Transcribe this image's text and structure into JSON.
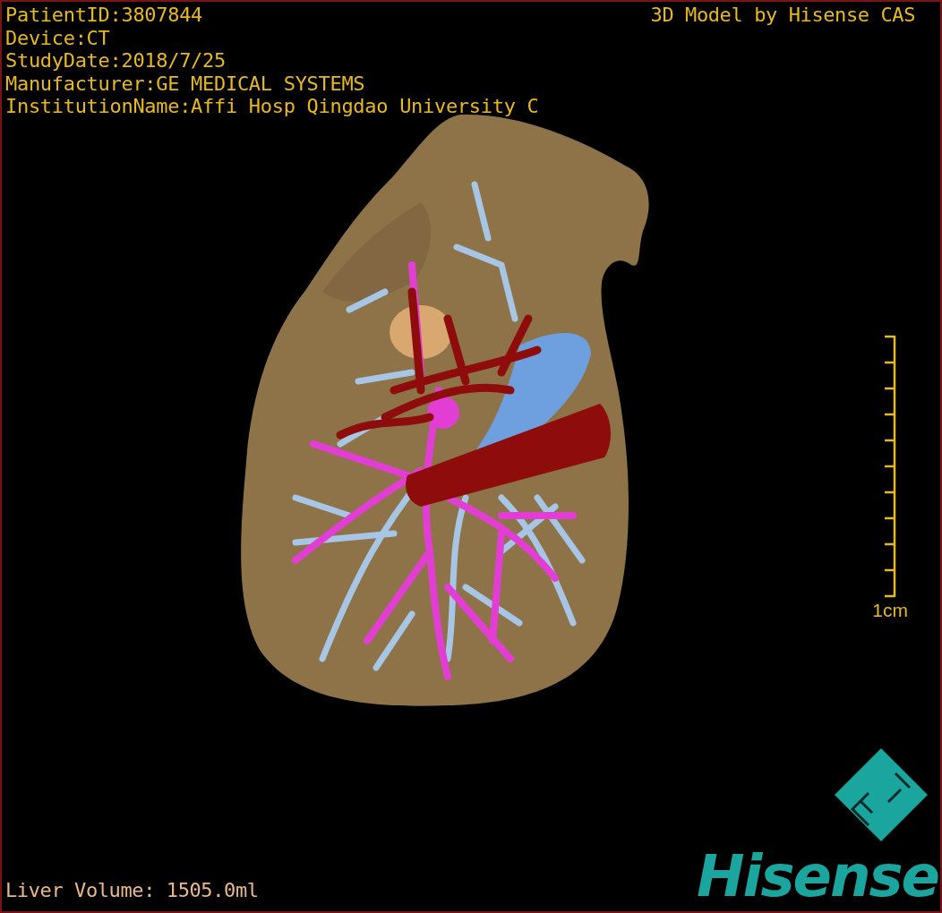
{
  "patient_info": [
    "PatientID:3807844",
    "Device:CT",
    "StudyDate:2018/7/25",
    "Manufacturer:GE MEDICAL SYSTEMS",
    "InstitutionName:Affi Hosp Qingdao University C"
  ],
  "credit": "3D Model by Hisense CAS",
  "scale_bar": {
    "label": "1cm"
  },
  "liver_volume": "Liver Volume: 1505.0ml",
  "logo": {
    "wordmark": "Hisense"
  }
}
